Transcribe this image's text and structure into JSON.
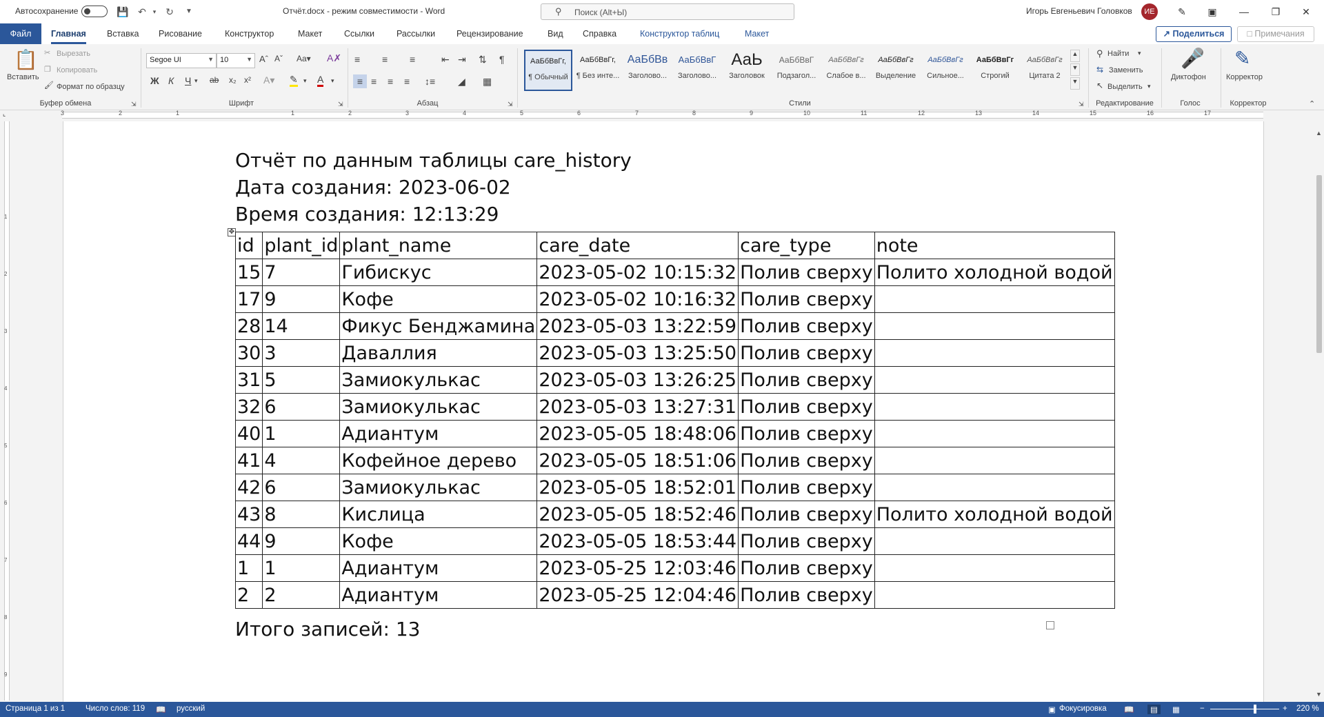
{
  "titlebar": {
    "autosave_label": "Автосохранение",
    "document_title": "Отчёт.docx  -  режим совместимости  -  Word",
    "search_placeholder": "Поиск (Alt+Ы)",
    "user_name": "Игорь Евгеньевич Головков",
    "user_initials": "ИЕ"
  },
  "tabs": {
    "file": "Файл",
    "items": [
      "Главная",
      "Вставка",
      "Рисование",
      "Конструктор",
      "Макет",
      "Ссылки",
      "Рассылки",
      "Рецензирование",
      "Вид",
      "Справка",
      "Конструктор таблиц",
      "Макет"
    ],
    "share": "Поделиться",
    "comments": "Примечания"
  },
  "ribbon": {
    "clipboard": {
      "paste": "Вставить",
      "cut": "Вырезать",
      "copy": "Копировать",
      "format_painter": "Формат по образцу",
      "label": "Буфер обмена"
    },
    "font": {
      "name": "Segoe UI",
      "size": "10",
      "bold": "Ж",
      "italic": "К",
      "underline": "Ч",
      "strike": "ab",
      "label": "Шрифт"
    },
    "paragraph": {
      "label": "Абзац"
    },
    "styles": {
      "label": "Стили",
      "items": [
        {
          "sample": "АаБбВвГг,",
          "name": "¶ Обычный"
        },
        {
          "sample": "АаБбВвГг,",
          "name": "¶ Без инте..."
        },
        {
          "sample": "АаБбВв",
          "name": "Заголово..."
        },
        {
          "sample": "АаБбВвГ",
          "name": "Заголово..."
        },
        {
          "sample": "АаЬ",
          "name": "Заголовок"
        },
        {
          "sample": "АаБбВвГ",
          "name": "Подзагол..."
        },
        {
          "sample": "АаБбВвГг",
          "name": "Слабое в..."
        },
        {
          "sample": "АаБбВвГг",
          "name": "Выделение"
        },
        {
          "sample": "АаБбВвГг",
          "name": "Сильное..."
        },
        {
          "sample": "АаБбВвГг",
          "name": "Строгий"
        },
        {
          "sample": "АаБбВвГг",
          "name": "Цитата 2"
        }
      ]
    },
    "editing": {
      "find": "Найти",
      "replace": "Заменить",
      "select": "Выделить",
      "label": "Редактирование"
    },
    "voice": {
      "dictate": "Диктофон",
      "label": "Голос"
    },
    "editor": {
      "button": "Корректор",
      "label": "Корректор"
    }
  },
  "ruler": {
    "h_numbers": [
      "3",
      "2",
      "1",
      "1",
      "2",
      "3",
      "4",
      "5",
      "6",
      "7",
      "8",
      "9",
      "10",
      "11",
      "12",
      "13",
      "14",
      "15",
      "16",
      "17"
    ],
    "v_numbers": [
      "1",
      "2",
      "3",
      "4",
      "5",
      "6",
      "7",
      "8",
      "9"
    ]
  },
  "document": {
    "title_line": "Отчёт по данным таблицы care_history",
    "date_line": "Дата создания: 2023-06-02",
    "time_line": "Время создания: 12:13:29",
    "table": {
      "headers": [
        "id",
        "plant_id",
        "plant_name",
        "care_date",
        "care_type",
        "note"
      ],
      "rows": [
        [
          "15",
          "7",
          "Гибискус",
          "2023-05-02 10:15:32",
          "Полив сверху",
          "Полито холодной водой"
        ],
        [
          "17",
          "9",
          "Кофе",
          "2023-05-02 10:16:32",
          "Полив сверху",
          ""
        ],
        [
          "28",
          "14",
          "Фикус Бенджамина",
          "2023-05-03 13:22:59",
          "Полив сверху",
          ""
        ],
        [
          "30",
          "3",
          "Даваллия",
          "2023-05-03 13:25:50",
          "Полив сверху",
          ""
        ],
        [
          "31",
          "5",
          "Замиокулькас",
          "2023-05-03 13:26:25",
          "Полив сверху",
          ""
        ],
        [
          "32",
          "6",
          "Замиокулькас",
          "2023-05-03 13:27:31",
          "Полив сверху",
          ""
        ],
        [
          "40",
          "1",
          "Адиантум",
          "2023-05-05 18:48:06",
          "Полив сверху",
          ""
        ],
        [
          "41",
          "4",
          "Кофейное дерево",
          "2023-05-05 18:51:06",
          "Полив сверху",
          ""
        ],
        [
          "42",
          "6",
          "Замиокулькас",
          "2023-05-05 18:52:01",
          "Полив сверху",
          ""
        ],
        [
          "43",
          "8",
          "Кислица",
          "2023-05-05 18:52:46",
          "Полив сверху",
          "Полито холодной водой"
        ],
        [
          "44",
          "9",
          "Кофе",
          "2023-05-05 18:53:44",
          "Полив сверху",
          ""
        ],
        [
          "1",
          "1",
          "Адиантум",
          "2023-05-25 12:03:46",
          "Полив сверху",
          ""
        ],
        [
          "2",
          "2",
          "Адиантум",
          "2023-05-25 12:04:46",
          "Полив сверху",
          ""
        ]
      ]
    },
    "total_line": "Итого записей: 13"
  },
  "status": {
    "page": "Страница 1 из 1",
    "words": "Число слов: 119",
    "language": "русский",
    "focus": "Фокусировка",
    "zoom": "220 %"
  },
  "colors": {
    "accent": "#2b579a",
    "avatar": "#a4262c"
  }
}
